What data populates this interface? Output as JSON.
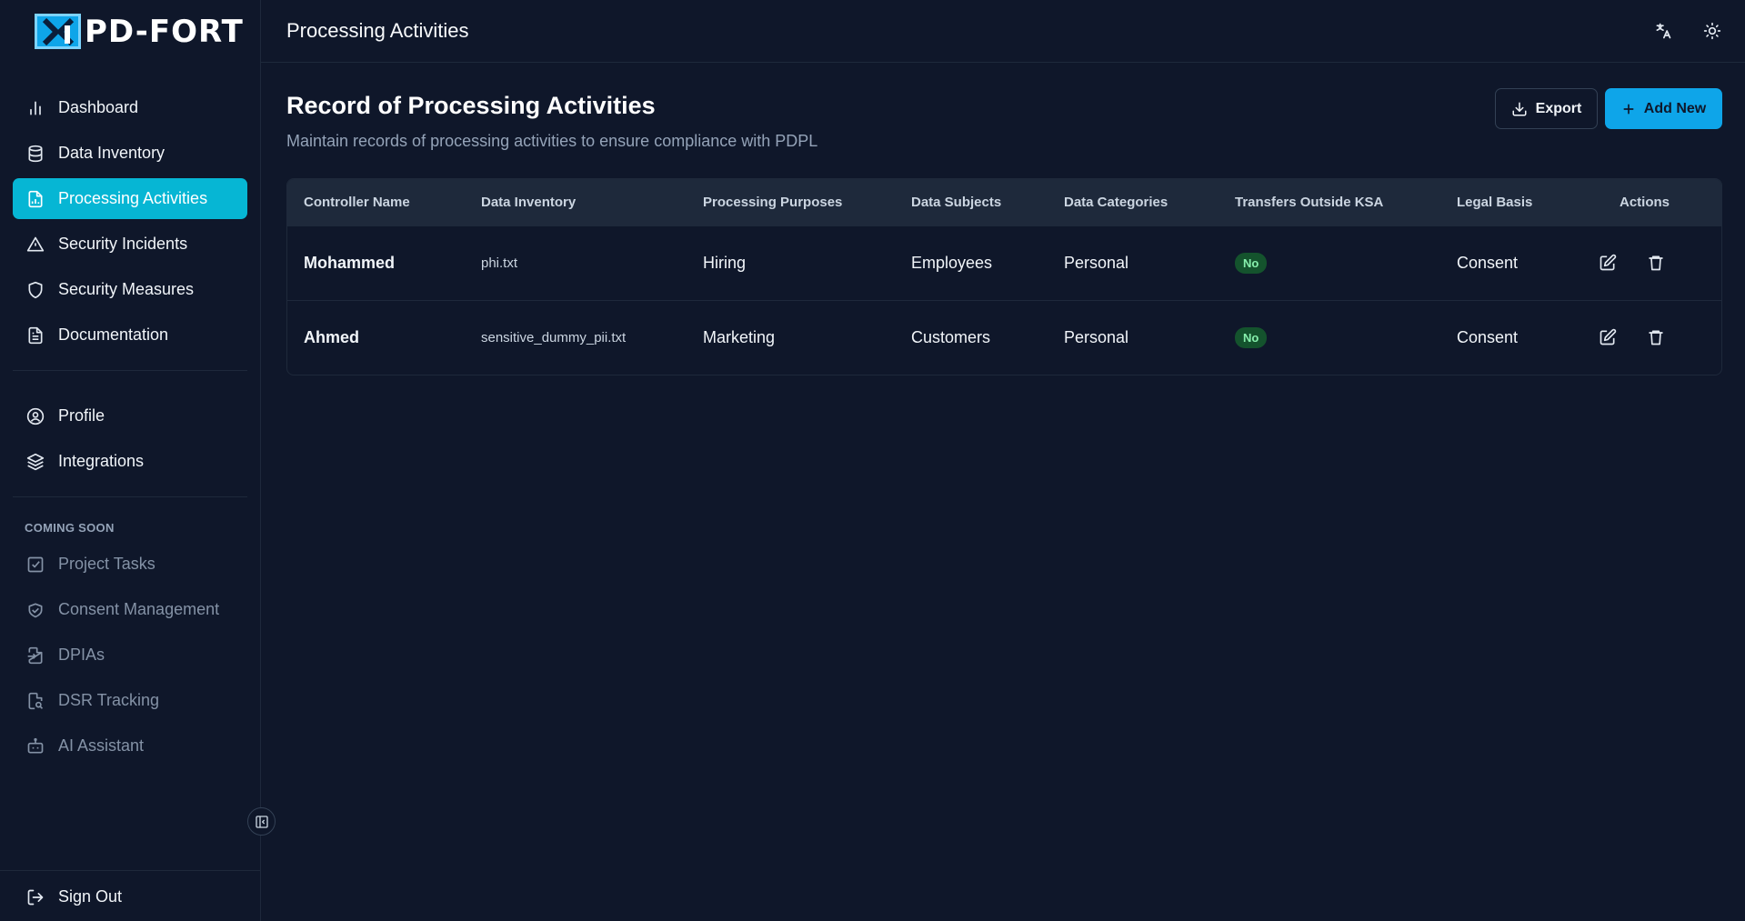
{
  "brand": {
    "logo_text": "PD-FORT"
  },
  "topbar": {
    "title": "Processing Activities",
    "icons": [
      "translate-icon",
      "sun-icon"
    ]
  },
  "sidebar": {
    "main_items": [
      {
        "label": "Dashboard",
        "icon": "bar-chart-icon"
      },
      {
        "label": "Data Inventory",
        "icon": "database-icon"
      },
      {
        "label": "Processing Activities",
        "icon": "file-chart-icon",
        "active": true
      },
      {
        "label": "Security Incidents",
        "icon": "alert-triangle-icon"
      },
      {
        "label": "Security Measures",
        "icon": "shield-icon"
      },
      {
        "label": "Documentation",
        "icon": "file-text-icon"
      }
    ],
    "account_items": [
      {
        "label": "Profile",
        "icon": "user-circle-icon"
      },
      {
        "label": "Integrations",
        "icon": "layers-icon"
      }
    ],
    "coming_soon_label": "COMING SOON",
    "coming_soon_items": [
      {
        "label": "Project Tasks",
        "icon": "checkbox-icon"
      },
      {
        "label": "Consent Management",
        "icon": "handshake-icon"
      },
      {
        "label": "DPIAs",
        "icon": "file-import-icon"
      },
      {
        "label": "DSR Tracking",
        "icon": "file-search-icon"
      },
      {
        "label": "AI Assistant",
        "icon": "bot-icon"
      }
    ],
    "sign_out": "Sign Out"
  },
  "page": {
    "title": "Record of Processing Activities",
    "subtitle": "Maintain records of processing activities to ensure compliance with PDPL",
    "export_label": "Export",
    "add_label": "Add New"
  },
  "table": {
    "headers": [
      "Controller Name",
      "Data Inventory",
      "Processing Purposes",
      "Data Subjects",
      "Data Categories",
      "Transfers Outside KSA",
      "Legal Basis",
      "Actions"
    ],
    "rows": [
      {
        "controller": "Mohammed",
        "inventory": "phi.txt",
        "purpose": "Hiring",
        "subjects": "Employees",
        "categories": "Personal",
        "transfers": "No",
        "legal_basis": "Consent"
      },
      {
        "controller": "Ahmed",
        "inventory": "sensitive_dummy_pii.txt",
        "purpose": "Marketing",
        "subjects": "Customers",
        "categories": "Personal",
        "transfers": "No",
        "legal_basis": "Consent"
      }
    ]
  },
  "colors": {
    "background": "#0f172a",
    "accent": "#06b6d4",
    "primary_button": "#0ea5e9",
    "badge_green": "#14532d"
  }
}
